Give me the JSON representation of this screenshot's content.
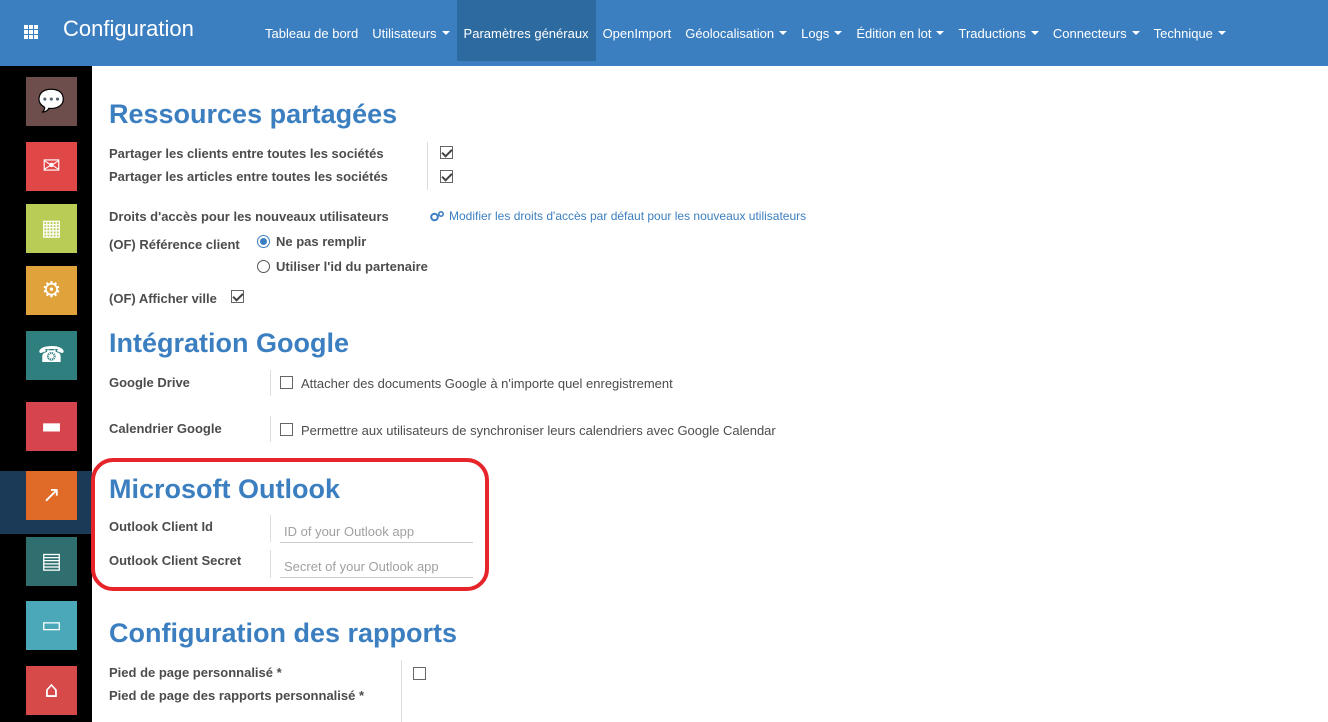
{
  "topbar": {
    "title": "Configuration",
    "menu": [
      {
        "label": "Tableau de bord",
        "caret": false,
        "active": false
      },
      {
        "label": "Utilisateurs",
        "caret": true,
        "active": false
      },
      {
        "label": "Paramètres généraux",
        "caret": false,
        "active": true
      },
      {
        "label": "OpenImport",
        "caret": false,
        "active": false
      },
      {
        "label": "Géolocalisation",
        "caret": true,
        "active": false
      },
      {
        "label": "Logs",
        "caret": true,
        "active": false
      },
      {
        "label": "Édition en lot",
        "caret": true,
        "active": false
      },
      {
        "label": "Traductions",
        "caret": true,
        "active": false
      },
      {
        "label": "Connecteurs",
        "caret": true,
        "active": false
      },
      {
        "label": "Technique",
        "caret": true,
        "active": false
      }
    ]
  },
  "sidebar": {
    "apps": [
      {
        "name": "discuss-app",
        "color": "#6e4d4d"
      },
      {
        "name": "mail-app",
        "color": "#e04848"
      },
      {
        "name": "calendar-app",
        "color": "#b9cc55"
      },
      {
        "name": "geolocation-app",
        "color": "#e0a23a"
      },
      {
        "name": "contacts-app",
        "color": "#2f7f7f"
      },
      {
        "name": "documents-app",
        "color": "#d6454d"
      },
      {
        "name": "reporting-app",
        "color": "#e06a28"
      },
      {
        "name": "forms-app",
        "color": "#2f6f6f"
      },
      {
        "name": "payment-app",
        "color": "#4aa8b8"
      },
      {
        "name": "website-app",
        "color": "#d64a4a"
      }
    ]
  },
  "sections": {
    "shared": {
      "title": "Ressources partagées",
      "share_clients": "Partager les clients entre toutes les sociétés",
      "share_articles": "Partager les articles entre toutes les sociétés",
      "access_rights_label": "Droits d'accès pour les nouveaux utilisateurs",
      "access_rights_link": "Modifier les droits d'accès par défaut pour les nouveaux utilisateurs",
      "client_ref_label": "(OF) Référence client",
      "client_ref_opt1": "Ne pas remplir",
      "client_ref_opt2": "Utiliser l'id du partenaire",
      "show_city_label": "(OF) Afficher ville"
    },
    "google": {
      "title": "Intégration Google",
      "drive_label": "Google Drive",
      "drive_option": "Attacher des documents Google à n'importe quel enregistrement",
      "calendar_label": "Calendrier Google",
      "calendar_option": "Permettre aux utilisateurs de synchroniser leurs calendriers avec Google Calendar"
    },
    "outlook": {
      "title": "Microsoft Outlook",
      "client_id_label": "Outlook Client Id",
      "client_id_placeholder": "ID of your Outlook app",
      "client_secret_label": "Outlook Client Secret",
      "client_secret_placeholder": "Secret of your Outlook app"
    },
    "reports": {
      "title": "Configuration des rapports",
      "footer_label": "Pied de page personnalisé *",
      "report_footer_label": "Pied de page des rapports personnalisé *"
    }
  }
}
